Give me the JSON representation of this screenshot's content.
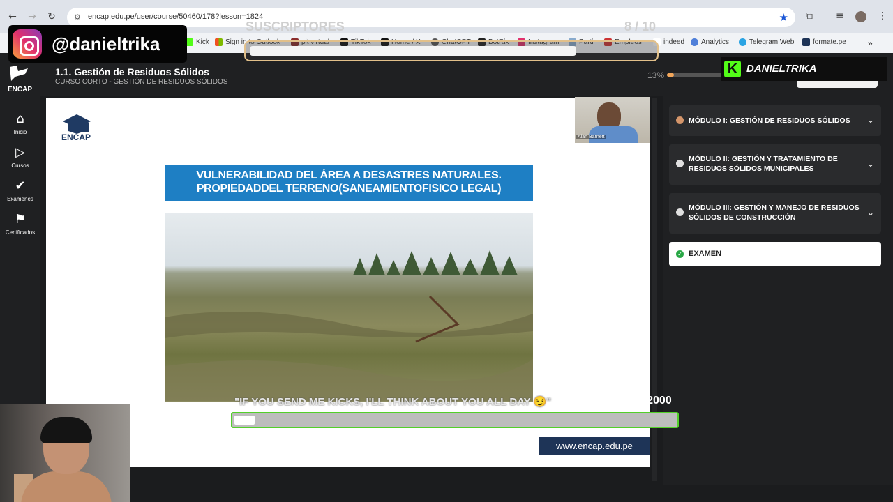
{
  "browser": {
    "url": "encap.edu.pe/user/course/50460/178?lesson=1824",
    "bookmarks": [
      "Kick",
      "Sign in to Outlook",
      "pit virtual",
      "TikTok",
      "Home / X",
      "ChatGPT",
      "BotRix",
      "Instagram",
      "Parti",
      "Empleos",
      "indeed",
      "Analytics",
      "Telegram Web",
      "formate.pe"
    ]
  },
  "overlay": {
    "instagram_handle": "@danieltrika",
    "subs_title": "SUSCRIPTORES",
    "subs_count": "8 / 10",
    "subs_progress": 0.8,
    "kick_name": "DANIELTRIKA",
    "goal_text": "\"IF YOU SEND ME KICKS, I'LL THINK ABOUT YOU ALL DAY 😏\"",
    "goal_count": "91 / 2000",
    "goal_progress": 0.045
  },
  "app": {
    "logo": "ENCAP",
    "lesson_title": "1.1. Gestión de Residuos Sólidos",
    "lesson_subtitle": "CURSO CORTO - GESTIÓN DE RESIDUOS SÓLIDOS",
    "progress_label": "13%",
    "progress_value": 0.13,
    "sidebar": [
      {
        "label": "Inicio",
        "icon": "home-icon"
      },
      {
        "label": "Cursos",
        "icon": "play-icon"
      },
      {
        "label": "Exámenes",
        "icon": "check-icon"
      },
      {
        "label": "Certificados",
        "icon": "bookmark-icon"
      }
    ],
    "slide": {
      "logo_text": "ENCAP",
      "presenter_name": "Alan Barnett",
      "banner_line1": "VULNERABILIDAD DEL ÁREA A DESASTRES NATURALES.",
      "banner_line2": "PROPIEDADDEL TERRENO(SANEAMIENTOFISICO LEGAL)",
      "footer_url": "www.encap.edu.pe"
    },
    "modules": [
      {
        "label": "MÓDULO I: GESTIÓN DE RESIDUOS SÓLIDOS",
        "status_color": "#d4956a"
      },
      {
        "label": "MÓDULO II: GESTIÓN Y TRATAMIENTO DE RESIDUOS SÓLIDOS MUNICIPALES",
        "status_color": "#e0e0e0"
      },
      {
        "label": "MÓDULO III: GESTIÓN Y MANEJO DE RESIDUOS SÓLIDOS DE CONSTRUCCIÓN",
        "status_color": "#e0e0e0"
      }
    ],
    "exam_label": "EXAMEN"
  }
}
